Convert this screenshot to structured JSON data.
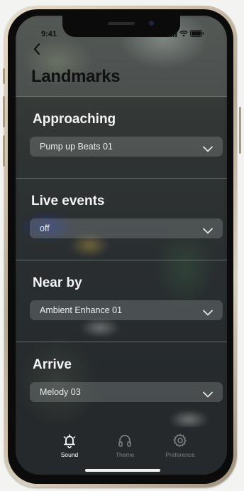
{
  "status_bar": {
    "time": "9:41"
  },
  "header": {
    "back_icon": "chevron-left-icon",
    "title": "Landmarks"
  },
  "sections": [
    {
      "label": "Approaching",
      "value": "Pump up Beats 01"
    },
    {
      "label": "Live events",
      "value": "off"
    },
    {
      "label": "Near by",
      "value": "Ambient Enhance 01"
    },
    {
      "label": "Arrive",
      "value": "Melody 03"
    }
  ],
  "tabbar": {
    "tabs": [
      {
        "label": "Sound",
        "icon": "bell-icon",
        "active": true
      },
      {
        "label": "Theme",
        "icon": "headphones-icon",
        "active": false
      },
      {
        "label": "Preference",
        "icon": "gear-icon",
        "active": false
      }
    ],
    "active_color": "#ffffff",
    "inactive_color": "#7b7f82"
  }
}
